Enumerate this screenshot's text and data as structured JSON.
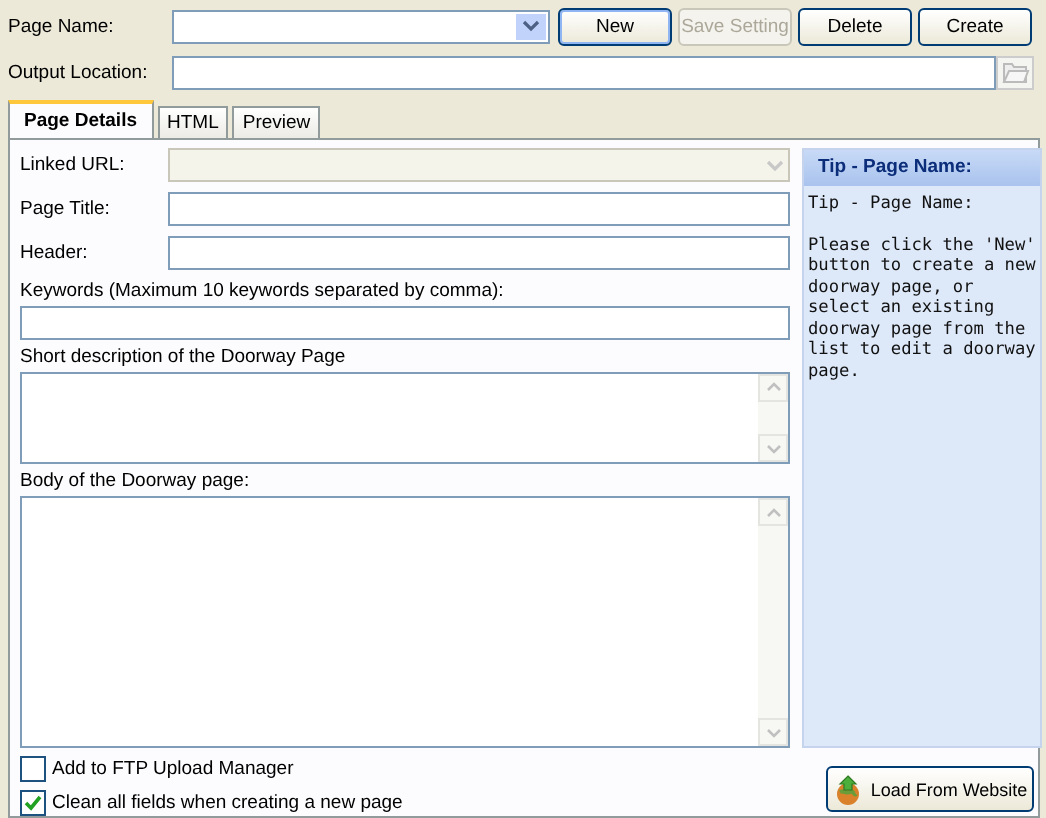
{
  "toolbar": {
    "page_name": {
      "label": "Page Name:"
    },
    "buttons": [
      {
        "label": "New",
        "disabled": false,
        "focused": true
      },
      {
        "label": "Save Setting",
        "disabled": true,
        "focused": false
      },
      {
        "label": "Delete",
        "disabled": false,
        "focused": false
      },
      {
        "label": "Create",
        "disabled": false,
        "focused": false
      }
    ],
    "output_location": {
      "label": "Output Location:"
    }
  },
  "tabs": [
    {
      "label": "Page Details",
      "selected": true
    },
    {
      "label": "HTML",
      "selected": false
    },
    {
      "label": "Preview",
      "selected": false
    }
  ],
  "form": {
    "linked_url": {
      "label": "Linked URL:",
      "disabled": true
    },
    "page_title": {
      "label": "Page Title:"
    },
    "header": {
      "label": "Header:"
    },
    "keywords": {
      "label": "Keywords (Maximum 10 keywords separated by comma):"
    },
    "short_description": {
      "label": "Short description of the Doorway Page"
    },
    "body": {
      "label": "Body of the Doorway page:"
    }
  },
  "options": [
    {
      "label": "Add to FTP Upload Manager",
      "checked": false
    },
    {
      "label": "Clean all fields when creating a new page",
      "checked": true
    }
  ],
  "load_button": {
    "label": "Load From Website"
  },
  "tip": {
    "title": "Tip - Page Name:",
    "heading": "Tip - Page Name:",
    "text": "Please click the 'New' button to create a new doorway page, or select an existing doorway page from the list to edit a doorway page."
  }
}
